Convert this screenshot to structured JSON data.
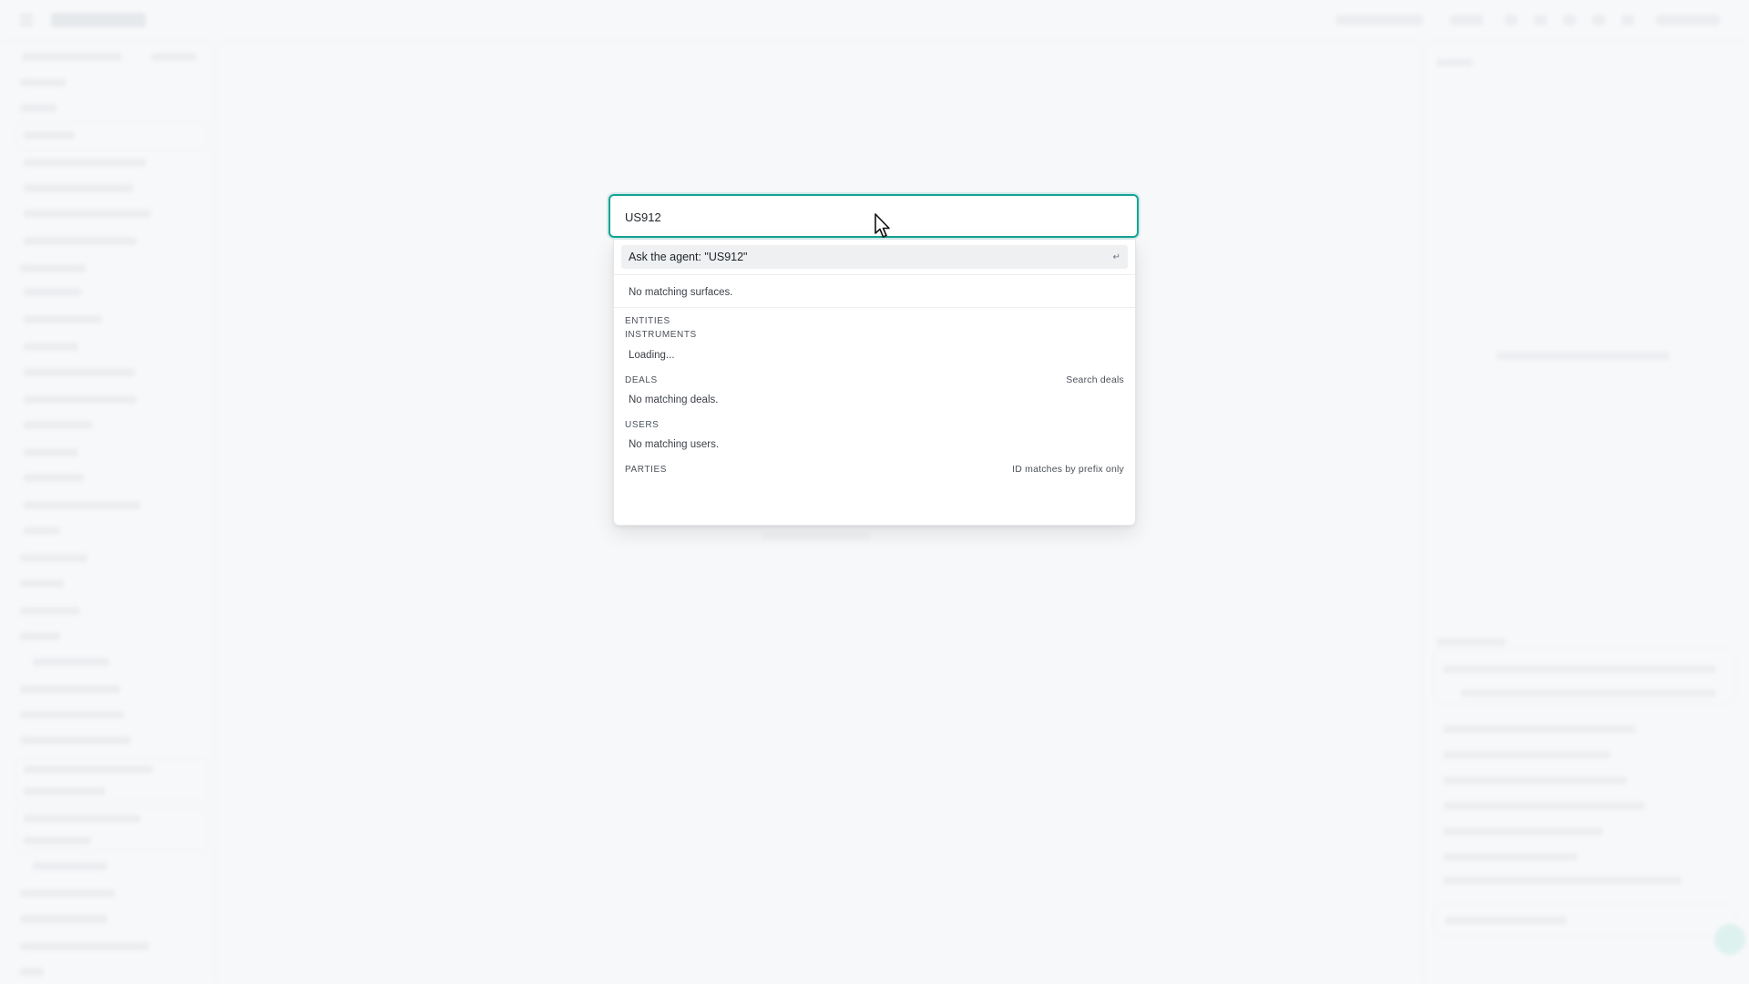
{
  "search": {
    "value": "US912"
  },
  "agent": {
    "label": "Ask the agent: \"US912\"",
    "enter_glyph": "↵"
  },
  "surfaces": {
    "empty_text": "No matching surfaces."
  },
  "sections": {
    "entities": {
      "header": "ENTITIES"
    },
    "instruments": {
      "header": "INSTRUMENTS",
      "status": "Loading..."
    },
    "deals": {
      "header": "DEALS",
      "action": "Search deals",
      "empty_text": "No matching deals."
    },
    "users": {
      "header": "USERS",
      "empty_text": "No matching users."
    },
    "parties": {
      "header": "PARTIES",
      "note": "ID matches by prefix only"
    }
  },
  "colors": {
    "accent": "#14a394",
    "backdrop": "#f7f8f9"
  },
  "icons": {
    "cursor": "mouse-pointer-icon",
    "enter": "enter-key-icon"
  }
}
